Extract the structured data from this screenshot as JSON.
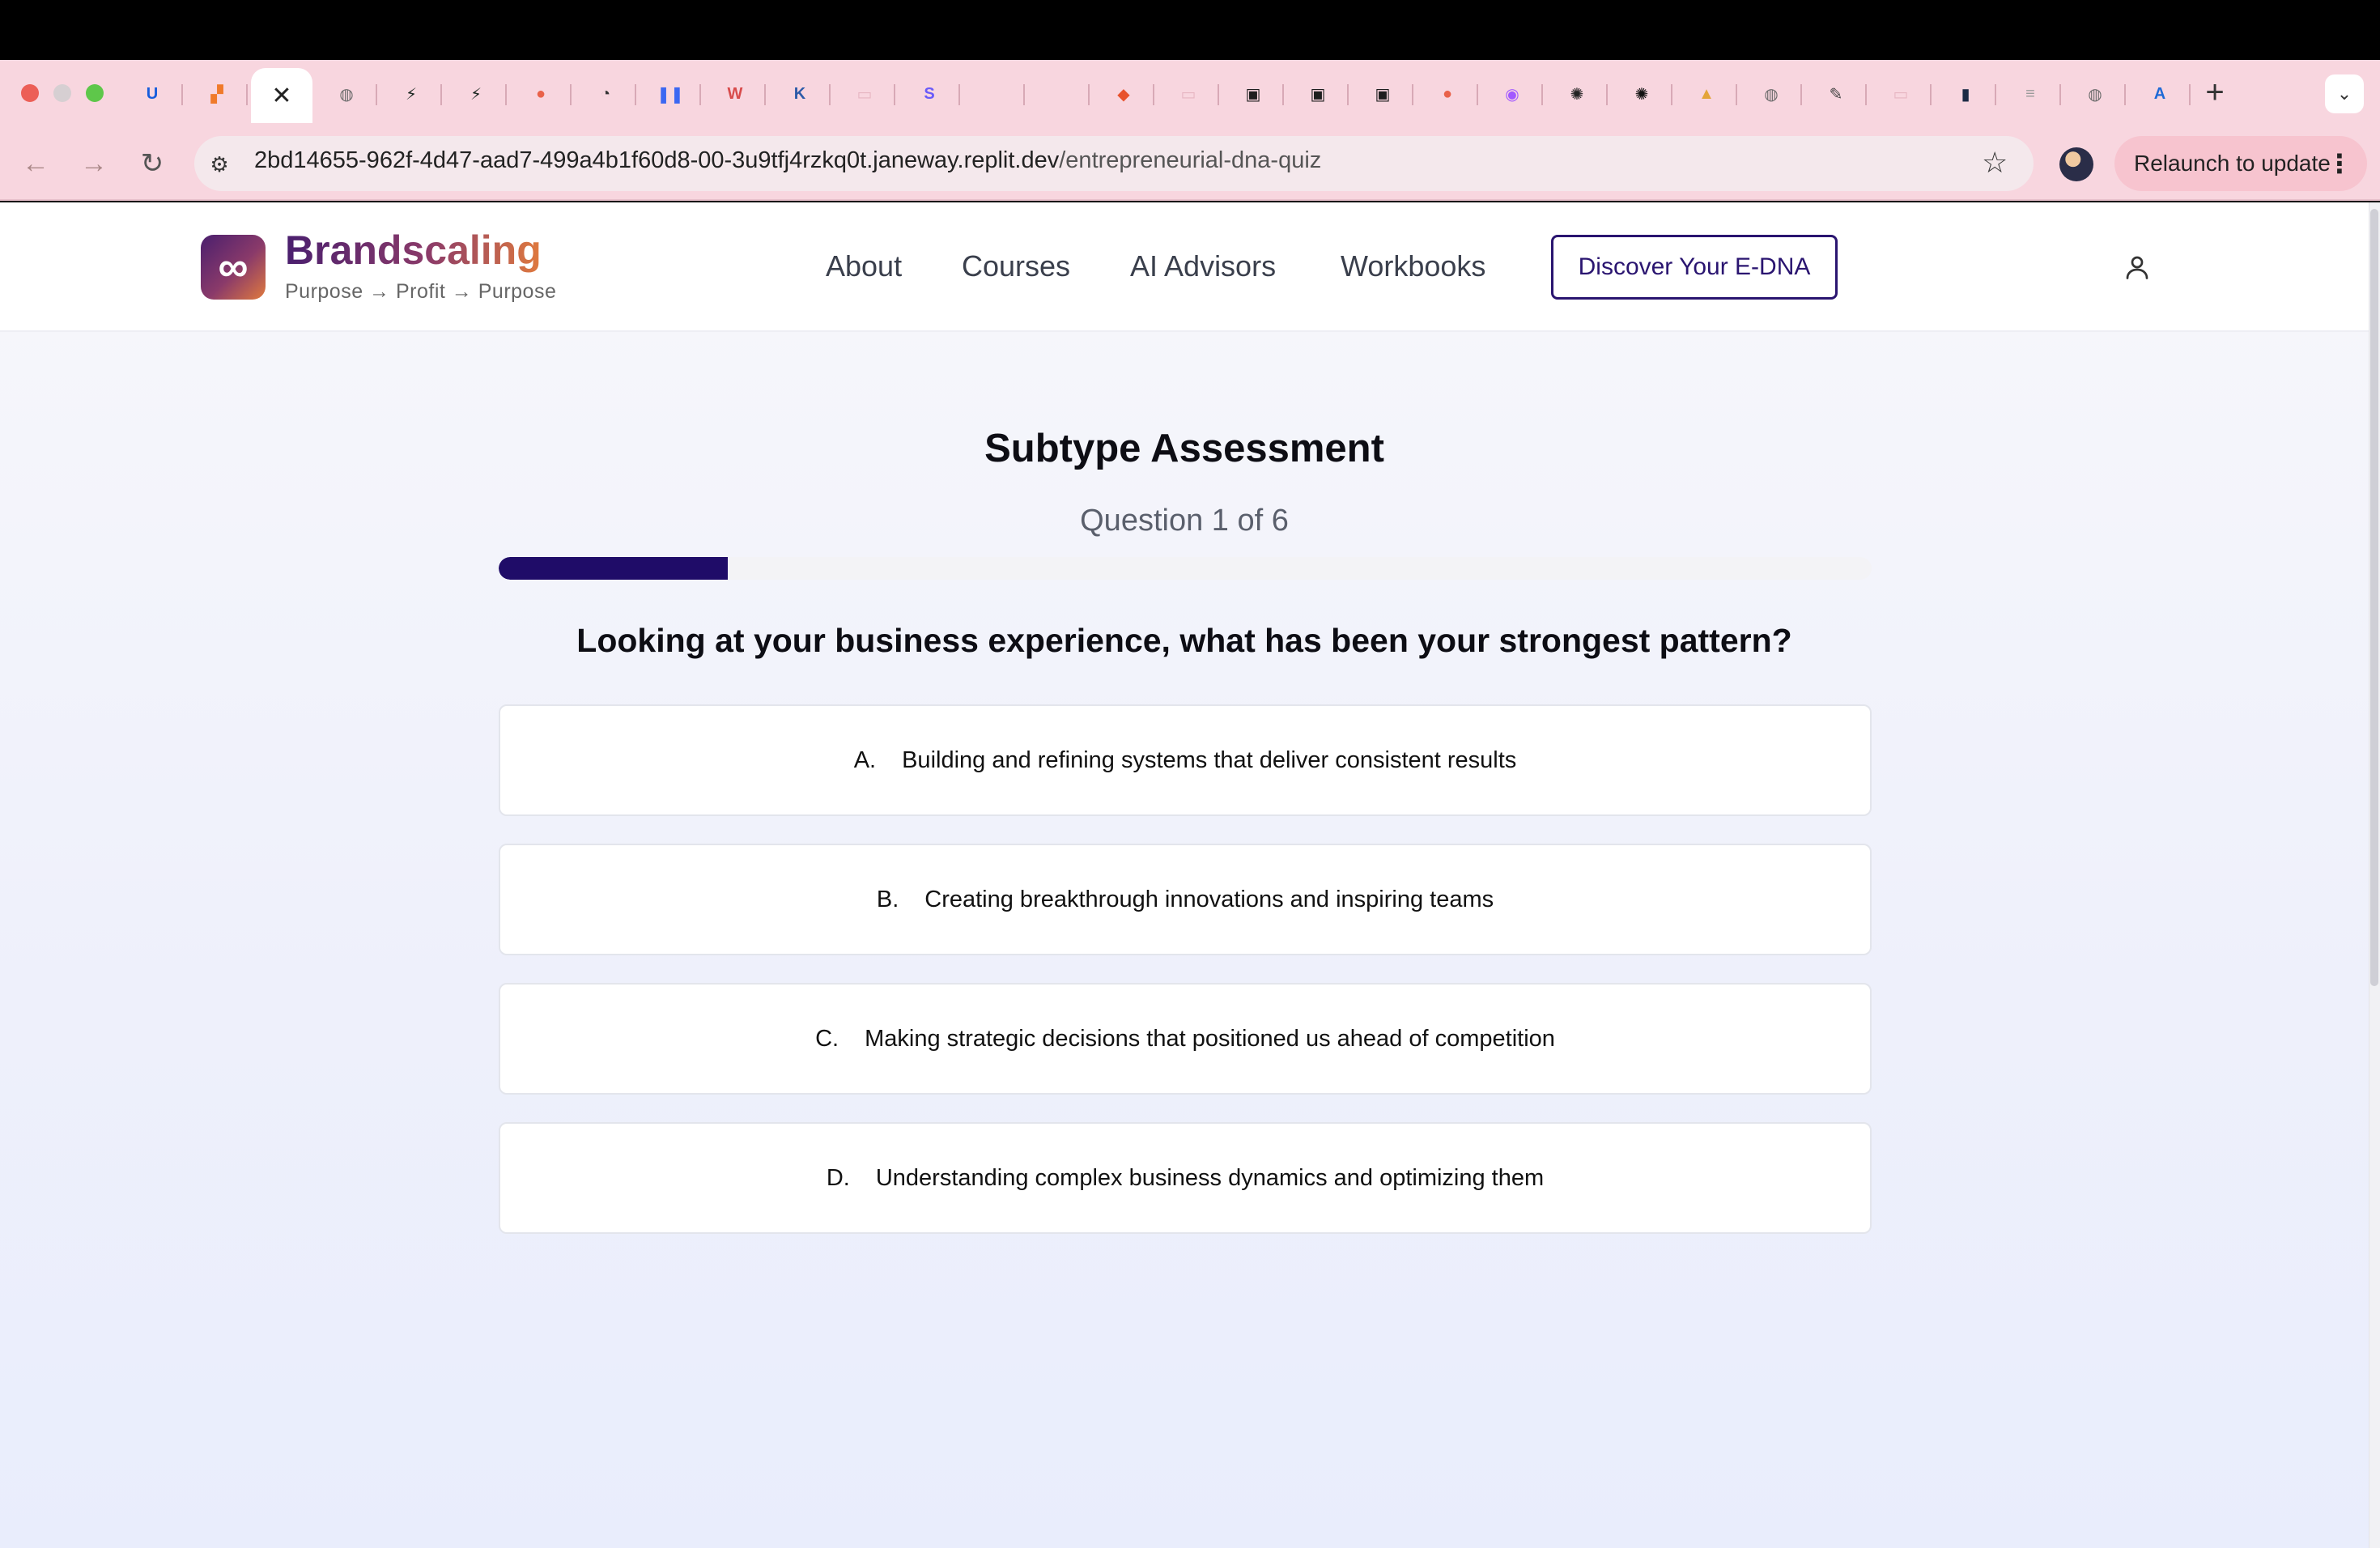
{
  "browser": {
    "tabs": [
      {
        "icon": "bitwarden-icon",
        "glyph": "U",
        "color": "#175ddc"
      },
      {
        "icon": "grid-orange-icon",
        "glyph": "▞",
        "color": "#f07a2a"
      },
      {
        "icon": "close-icon",
        "glyph": "✕",
        "color": "#ffffff",
        "active": true
      },
      {
        "icon": "globe-icon",
        "glyph": "◍",
        "color": "#6b6b6b"
      },
      {
        "icon": "bolt-green-icon",
        "glyph": "⚡",
        "color": "#1f2a24"
      },
      {
        "icon": "bolt-green-icon",
        "glyph": "⚡",
        "color": "#1f2a24"
      },
      {
        "icon": "heart-shape-icon",
        "glyph": "●",
        "color": "#e9624a"
      },
      {
        "icon": "activity-icon",
        "glyph": "◔",
        "color": "#333333"
      },
      {
        "icon": "pause-blue-icon",
        "glyph": "❚❚",
        "color": "#3b67f2"
      },
      {
        "icon": "w-circle-icon",
        "glyph": "W",
        "color": "#d84b4b"
      },
      {
        "icon": "k-icon",
        "glyph": "K",
        "color": "#2d5ba8"
      },
      {
        "icon": "page-thumb-icon",
        "glyph": "▭",
        "color": "#e7b6c2"
      },
      {
        "icon": "s-purple-icon",
        "glyph": "S",
        "color": "#6a5af9"
      },
      {
        "icon": "blank-icon",
        "glyph": "",
        "color": "#f8d6df"
      },
      {
        "icon": "blank-icon",
        "glyph": "",
        "color": "#f8d6df"
      },
      {
        "icon": "flame-icon",
        "glyph": "◆",
        "color": "#e8522c"
      },
      {
        "icon": "page-thumb-icon",
        "glyph": "▭",
        "color": "#e7b6c2"
      },
      {
        "icon": "tv-icon",
        "glyph": "▣",
        "color": "#1e1e1e"
      },
      {
        "icon": "tv-icon",
        "glyph": "▣",
        "color": "#1e1e1e"
      },
      {
        "icon": "tv-icon",
        "glyph": "▣",
        "color": "#1e1e1e"
      },
      {
        "icon": "heart-shape-icon",
        "glyph": "●",
        "color": "#e9624a"
      },
      {
        "icon": "figma-icon",
        "glyph": "◉",
        "color": "#a259ff"
      },
      {
        "icon": "openai-icon",
        "glyph": "✺",
        "color": "#222222"
      },
      {
        "icon": "openai-icon",
        "glyph": "✺",
        "color": "#111111"
      },
      {
        "icon": "triangle-multi-icon",
        "glyph": "▲",
        "color": "#e4a43a"
      },
      {
        "icon": "globe-icon",
        "glyph": "◍",
        "color": "#6b6b6b"
      },
      {
        "icon": "note-pen-icon",
        "glyph": "✎",
        "color": "#444444"
      },
      {
        "icon": "page-thumb-icon",
        "glyph": "▭",
        "color": "#e7b6c2"
      },
      {
        "icon": "bars-icon",
        "glyph": "▮",
        "color": "#1c2b45"
      },
      {
        "icon": "stripe-icon",
        "glyph": "≡",
        "color": "#9a9a9a"
      },
      {
        "icon": "globe-icon",
        "glyph": "◍",
        "color": "#6b6b6b"
      },
      {
        "icon": "azure-icon",
        "glyph": "A",
        "color": "#1f6ad6"
      }
    ],
    "url_host": "2bd14655-962f-4d47-aad7-499a4b1f60d8-00-3u9tfj4rzkq0t.janeway.replit.dev",
    "url_path": "/entrepreneurial-dna-quiz",
    "relaunch_label": "Relaunch to update"
  },
  "site": {
    "brand_name": "Brandscaling",
    "brand_tagline": "Purpose → Profit → Purpose",
    "nav": [
      "About",
      "Courses",
      "AI Advisors",
      "Workbooks"
    ],
    "cta_label": "Discover Your E-DNA"
  },
  "quiz": {
    "title": "Subtype Assessment",
    "counter": "Question 1 of 6",
    "progress_fraction": 0.1667,
    "question": "Looking at your business experience, what has been your strongest pattern?",
    "options": [
      {
        "letter": "A.",
        "text": "Building and refining systems that deliver consistent results"
      },
      {
        "letter": "B.",
        "text": "Creating breakthrough innovations and inspiring teams"
      },
      {
        "letter": "C.",
        "text": "Making strategic decisions that positioned us ahead of competition"
      },
      {
        "letter": "D.",
        "text": "Understanding complex business dynamics and optimizing them"
      }
    ]
  }
}
